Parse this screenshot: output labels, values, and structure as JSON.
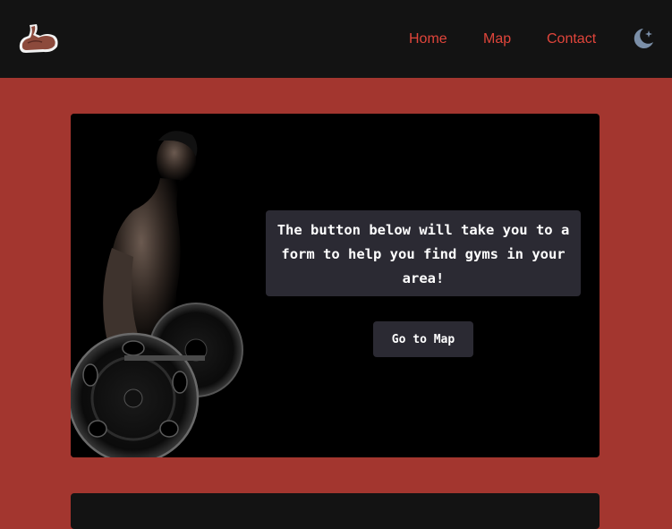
{
  "nav": {
    "links": [
      {
        "label": "Home"
      },
      {
        "label": "Map"
      },
      {
        "label": "Contact"
      }
    ],
    "theme_icon": "moon-star-icon",
    "logo_icon": "flexed-arm-icon",
    "link_color": "#e0453b",
    "background": "#131313"
  },
  "hero": {
    "image": "bodybuilder-barbell-photo",
    "message": "The button below will take you to a form to help you find gyms in your area!",
    "button_label": "Go to Map",
    "box_color": "#2b2a33"
  },
  "page": {
    "background": "#a3362f"
  }
}
